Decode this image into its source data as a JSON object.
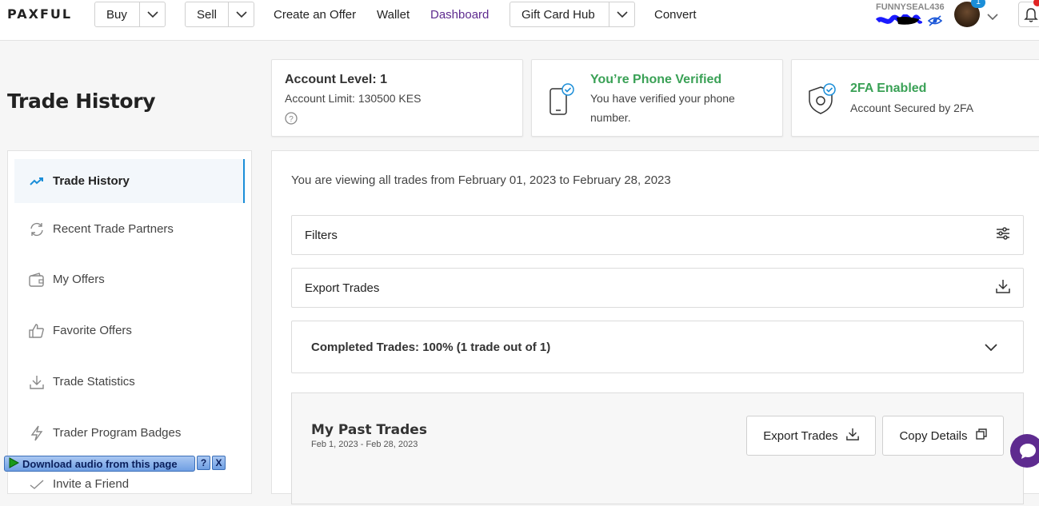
{
  "nav": {
    "logo": "PAXFUL",
    "buy": "Buy",
    "sell": "Sell",
    "create_offer": "Create an Offer",
    "wallet": "Wallet",
    "dashboard": "Dashboard",
    "gift_card_hub": "Gift Card Hub",
    "convert": "Convert",
    "username": "FUNNYSEAL436",
    "notification_count": "1"
  },
  "page": {
    "title": "Trade History"
  },
  "cards": {
    "level": {
      "title": "Account Level: 1",
      "limit": "Account Limit: 130500 KES"
    },
    "phone": {
      "title": "You’re Phone Verified",
      "text": "You have verified your phone number."
    },
    "twofa": {
      "title": "2FA Enabled",
      "text": "Account Secured by 2FA"
    }
  },
  "sidebar": {
    "items": [
      {
        "label": "Trade History",
        "icon": "trending-up-icon"
      },
      {
        "label": "Recent Trade Partners",
        "icon": "refresh-icon"
      },
      {
        "label": "My Offers",
        "icon": "wallet-icon"
      },
      {
        "label": "Favorite Offers",
        "icon": "thumbs-up-icon"
      },
      {
        "label": "Trade Statistics",
        "icon": "download-icon"
      },
      {
        "label": "Trader Program Badges",
        "icon": "lightning-icon"
      },
      {
        "label": "Invite a Friend",
        "icon": "check-icon"
      }
    ]
  },
  "main": {
    "range_text": "You are viewing all trades from February 01, 2023 to February 28, 2023",
    "filters": "Filters",
    "export_trades": "Export Trades",
    "completed": "Completed Trades: 100% (1 trade out of 1)",
    "past_title": "My Past Trades",
    "past_range": "Feb 1, 2023 - Feb 28, 2023",
    "export_btn": "Export Trades",
    "copy_btn": "Copy Details"
  },
  "overlay": {
    "download_audio": "Download audio from this page",
    "help": "?",
    "close": "X"
  },
  "colors": {
    "accent_purple": "#5e2b8f",
    "verified_green": "#3aa156",
    "blue": "#1b8ed8"
  }
}
